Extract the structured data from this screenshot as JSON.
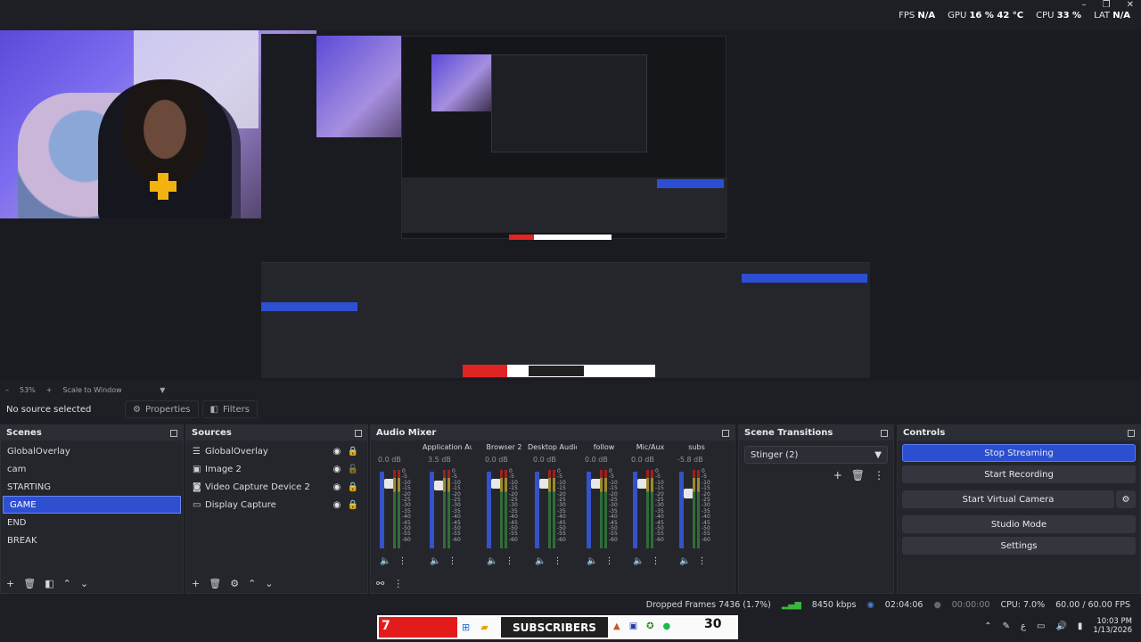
{
  "stats": {
    "fps_label": "FPS",
    "fps_value": "N/A",
    "gpu_label": "GPU",
    "gpu_value": "16 % 42 °C",
    "cpu_label": "CPU",
    "cpu_value": "33 %",
    "lat_label": "LAT",
    "lat_value": "N/A"
  },
  "window_controls": [
    "–",
    "❐",
    "✕"
  ],
  "zoom": {
    "minus": "–",
    "value": "53%",
    "plus": "+",
    "mode": "Scale to Window"
  },
  "propbar": {
    "no_source": "No source selected",
    "properties": "Properties",
    "filters": "Filters"
  },
  "scenes": {
    "title": "Scenes",
    "items": [
      "GlobalOverlay",
      "cam",
      "STARTING",
      "GAME",
      "END",
      "BREAK"
    ],
    "selected": "GAME"
  },
  "sources": {
    "title": "Sources",
    "items": [
      {
        "label": "GlobalOverlay",
        "icon": "list-icon"
      },
      {
        "label": "Image 2",
        "icon": "image-icon"
      },
      {
        "label": "Video Capture Device 2",
        "icon": "camera-icon"
      },
      {
        "label": "Display Capture",
        "icon": "monitor-icon"
      }
    ]
  },
  "mixer": {
    "title": "Audio Mixer",
    "channels": [
      {
        "name": "",
        "db": "0.0 dB",
        "level": 0.85
      },
      {
        "name": "Application Audio C",
        "db": "3.5 dB",
        "level": 0.82
      },
      {
        "name": "Browser 2",
        "db": "0.0 dB",
        "level": 0.85
      },
      {
        "name": "Desktop Audio",
        "db": "0.0 dB",
        "level": 0.85
      },
      {
        "name": "follow",
        "db": "0.0 dB",
        "level": 0.85
      },
      {
        "name": "Mic/Aux",
        "db": "0.0 dB",
        "level": 0.85
      },
      {
        "name": "subs",
        "db": "-5.8 dB",
        "level": 0.72
      }
    ],
    "ticks": [
      "0",
      "-5",
      "-10",
      "-15",
      "-20",
      "-25",
      "-30",
      "-35",
      "-40",
      "-45",
      "-50",
      "-55",
      "-60"
    ]
  },
  "transitions": {
    "title": "Scene Transitions",
    "selected": "Stinger (2)"
  },
  "controls": {
    "title": "Controls",
    "stop_streaming": "Stop Streaming",
    "start_recording": "Start Recording",
    "start_virtual_camera": "Start Virtual Camera",
    "studio_mode": "Studio Mode",
    "settings": "Settings"
  },
  "status": {
    "dropped": "Dropped Frames 7436 (1.7%)",
    "kbps": "8450 kbps",
    "stream_time": "02:04:06",
    "rec_time": "00:00:00",
    "cpu": "CPU: 7.0%",
    "fps": "60.00 / 60.00 FPS"
  },
  "taskbar": {
    "left_count": "7",
    "subscribers": "SUBSCRIBERS",
    "right_count": "30",
    "time": "10:03 PM",
    "date": "1/13/2026"
  }
}
